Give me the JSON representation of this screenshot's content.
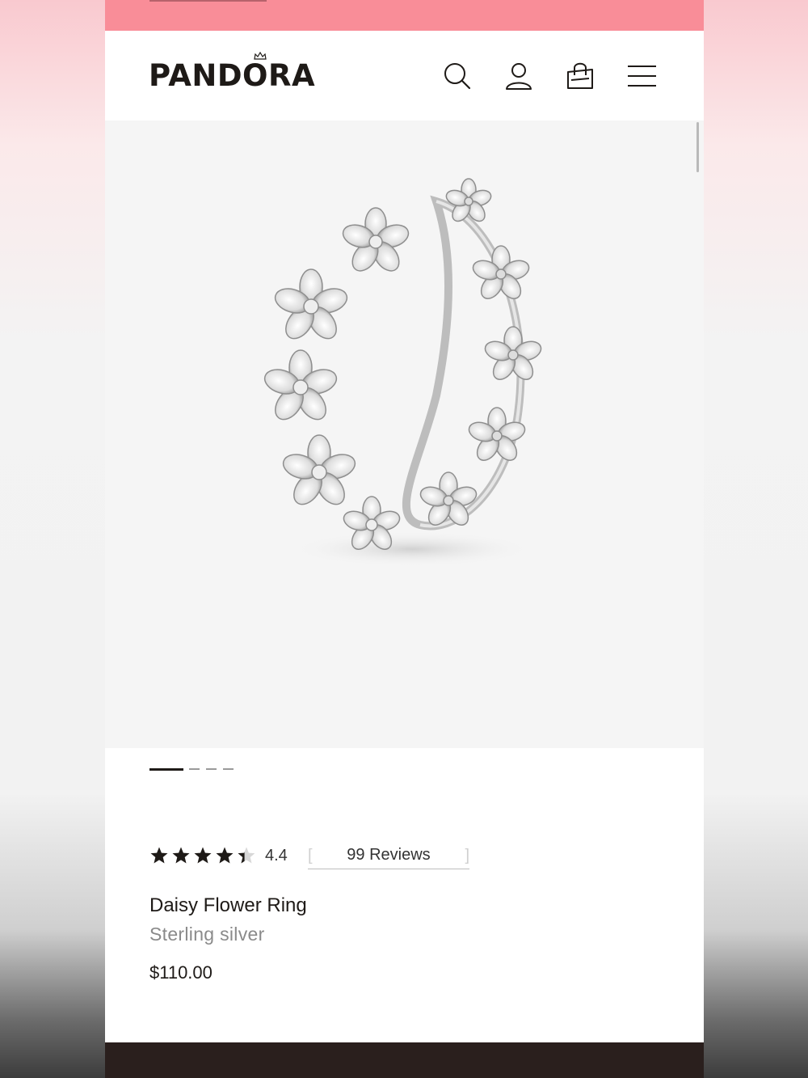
{
  "brand": {
    "logo_text": "PANDORA",
    "color": "#1e1a17"
  },
  "promo_bar": {
    "color": "#f98d98"
  },
  "header": {
    "icons": [
      "search-icon",
      "account-icon",
      "shopping-bag-icon",
      "menu-icon"
    ]
  },
  "carousel": {
    "slide_count": 4,
    "active_index": 0
  },
  "product": {
    "rating": 4.4,
    "rating_display": "4.4",
    "rating_max": 5,
    "reviews_label": "99 Reviews",
    "name": "Daisy Flower Ring",
    "material": "Sterling silver",
    "price": "$110.00"
  },
  "footer": {
    "color": "#2a1f1d"
  }
}
